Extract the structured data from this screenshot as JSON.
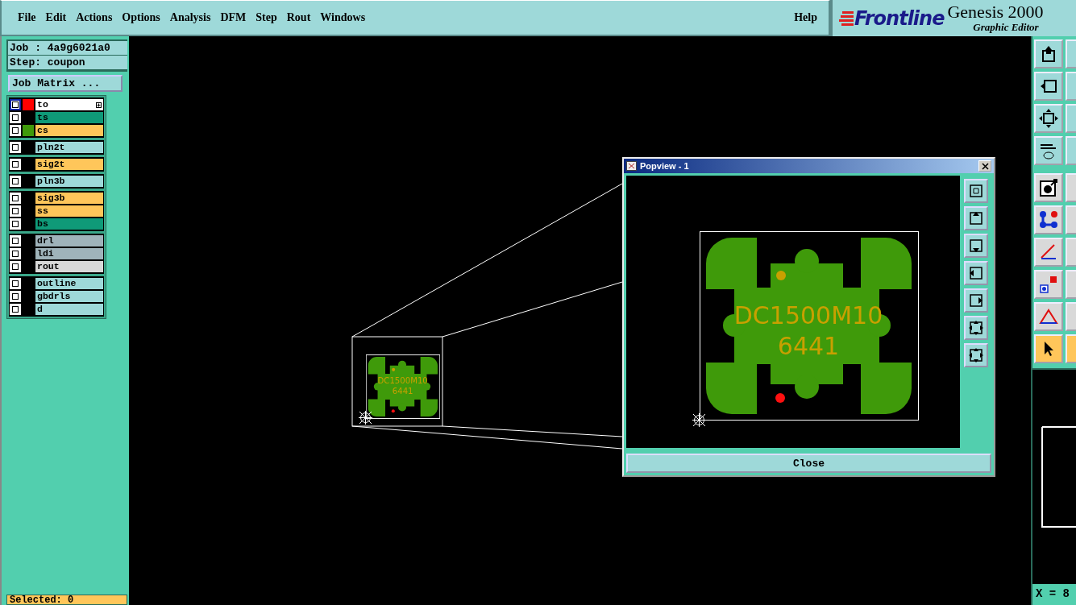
{
  "menu": [
    {
      "label": "File"
    },
    {
      "label": "Edit"
    },
    {
      "label": "Actions"
    },
    {
      "label": "Options"
    },
    {
      "label": "Analysis"
    },
    {
      "label": "DFM"
    },
    {
      "label": "Step"
    },
    {
      "label": "Rout"
    },
    {
      "label": "Windows"
    }
  ],
  "help": "Help",
  "logo": {
    "brand": "Frontline",
    "product": "Genesis 2000",
    "subtitle": "Graphic Editor"
  },
  "job": "Job : 4a9g6021a0",
  "step": "Step: coupon",
  "job_matrix": "Job Matrix ...",
  "layer_groups": [
    [
      {
        "name": "to",
        "color": "#ff0000",
        "checked": true,
        "selected": true
      },
      {
        "name": "ts",
        "kind": "mask",
        "checked": true,
        "selected": false
      },
      {
        "name": "cs",
        "kind": "signal",
        "color": "#3f9a0a",
        "checked": true,
        "selected": false
      }
    ],
    [
      {
        "name": "pln2t",
        "kind": "other",
        "checked": true,
        "selected": false
      }
    ],
    [
      {
        "name": "sig2t",
        "kind": "signal",
        "checked": true,
        "selected": false
      }
    ],
    [
      {
        "name": "pln3b",
        "kind": "other",
        "checked": true,
        "selected": false
      }
    ],
    [
      {
        "name": "sig3b",
        "kind": "signal",
        "checked": true,
        "selected": false
      },
      {
        "name": "ss",
        "kind": "signal",
        "checked": true,
        "selected": false
      },
      {
        "name": "bs",
        "kind": "mask",
        "checked": true,
        "selected": false
      }
    ],
    [
      {
        "name": "drl",
        "kind": "drill",
        "checked": true,
        "selected": false
      },
      {
        "name": "ldi",
        "kind": "drill",
        "checked": true,
        "selected": false
      },
      {
        "name": "rout",
        "kind": "rout",
        "checked": true,
        "selected": false
      }
    ],
    [
      {
        "name": "outline",
        "kind": "other",
        "checked": true,
        "selected": false
      },
      {
        "name": "gbdrls",
        "kind": "other",
        "checked": true,
        "selected": false
      },
      {
        "name": "d",
        "kind": "other",
        "checked": true,
        "selected": false
      }
    ]
  ],
  "status": "Selected: 0",
  "thumbnail_text": [
    "DC1500M10",
    "6441"
  ],
  "popview": {
    "title": "Popview - 1",
    "board_text": [
      "DC1500M10",
      "6441"
    ],
    "close": "Close"
  },
  "tools": [
    {
      "kind": "home",
      "selected": false
    },
    {
      "kind": "left",
      "selected": false
    },
    {
      "kind": "fit",
      "selected": false
    },
    {
      "kind": "wrench",
      "selected": false
    },
    {
      "kind": "pad",
      "selected": false
    },
    {
      "kind": "nodes",
      "selected": false
    },
    {
      "kind": "angle",
      "selected": false
    },
    {
      "kind": "squares",
      "selected": false
    },
    {
      "kind": "triangle",
      "selected": false
    },
    {
      "kind": "pointer",
      "selected": true
    }
  ],
  "coords": "X = 8"
}
